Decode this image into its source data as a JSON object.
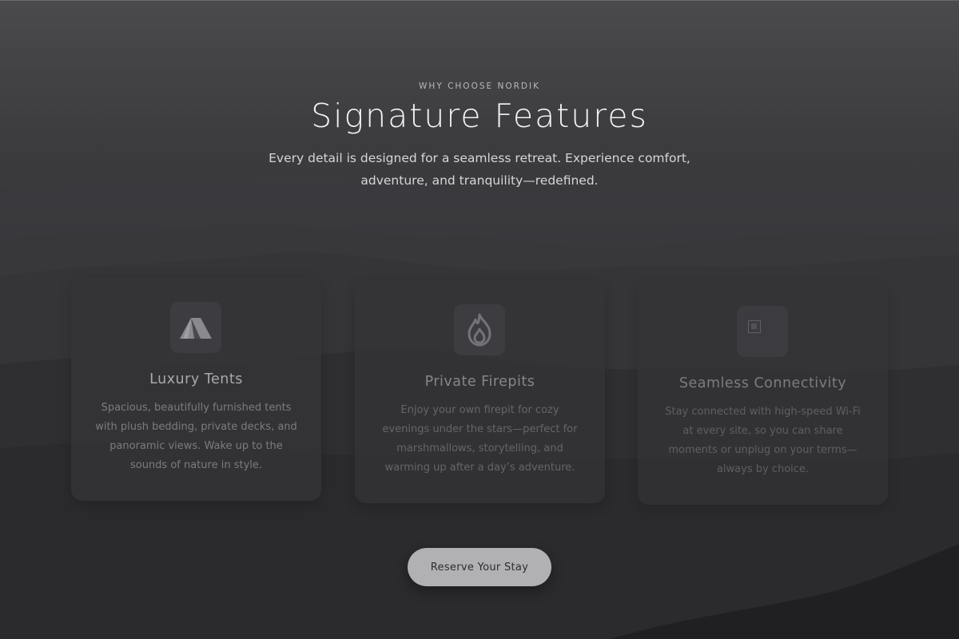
{
  "section": {
    "eyebrow": "WHY CHOOSE NORDIK",
    "title": "Signature Features",
    "subtitle": "Every detail is designed for a seamless retreat. Experience comfort, adventure, and tranquility—redefined."
  },
  "features": [
    {
      "icon": "tent-icon",
      "title": "Luxury Tents",
      "text": "Spacious, beautifully furnished tents with plush bedding, private decks, and panoramic views. Wake up to the sounds of nature in style."
    },
    {
      "icon": "flame-icon",
      "title": "Private Firepits",
      "text": "Enjoy your own firepit for cozy evenings under the stars—perfect for marshmallows, storytelling, and warming up after a day’s adventure."
    },
    {
      "icon": "broken-image-icon",
      "title": "Seamless Connectivity",
      "text": "Stay connected with high-speed Wi-Fi at every site, so you can share moments or unplug on your terms—always by choice."
    }
  ],
  "cta": {
    "label": "Reserve Your Stay"
  },
  "colors": {
    "background": "#2b2b2e",
    "card": "#343437",
    "button": "#b1b1b3",
    "title": "#f2f2f4"
  }
}
